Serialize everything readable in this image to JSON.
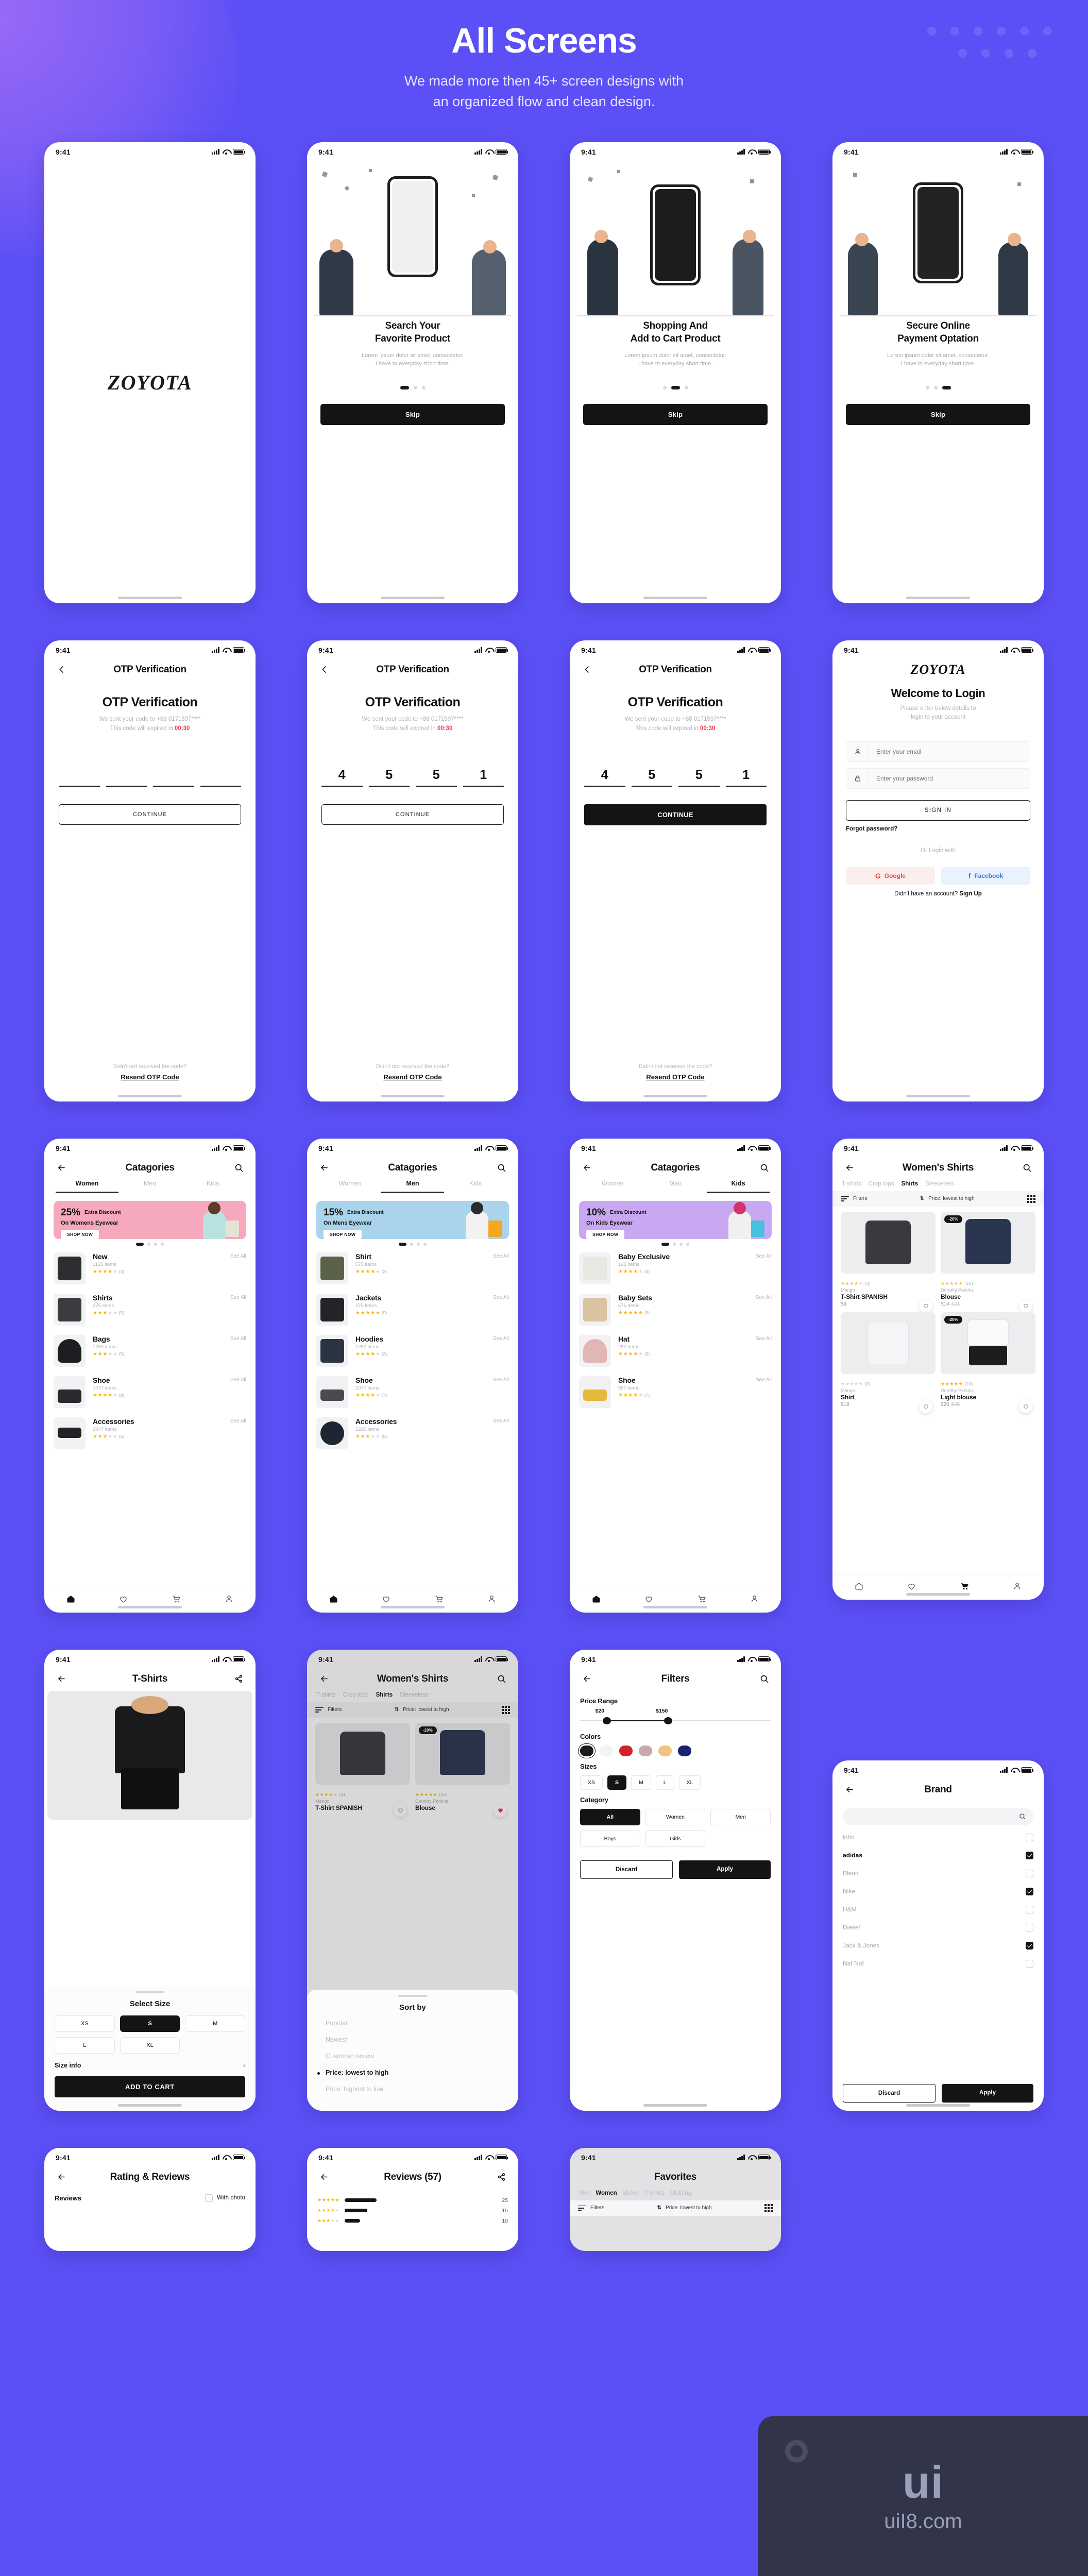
{
  "header": {
    "title": "All Screens",
    "subtitle_line1": "We made more then 45+ screen designs with",
    "subtitle_line2": "an organized flow and clean design."
  },
  "status_bar": {
    "time": "9:41"
  },
  "brand": {
    "name": "ZOYOTA"
  },
  "screens": {
    "splash": {
      "logo": "ZOYOTA"
    },
    "onboarding": [
      {
        "title_line1": "Search Your",
        "title_line2": "Favorite Product",
        "desc_line1": "Lorem ipsum dolor sit amet, consectetur.",
        "desc_line2": "I have to  everyday short time.",
        "button": "Skip",
        "active_dot": 0
      },
      {
        "title_line1": "Shopping And",
        "title_line2": "Add to Cart Product",
        "desc_line1": "Lorem ipsum dolor sit amet, consectetur.",
        "desc_line2": "I have to  everyday short time.",
        "button": "Skip",
        "active_dot": 1
      },
      {
        "title_line1": "Secure Online",
        "title_line2": "Payment Optation",
        "desc_line1": "Lorem ipsum dolor sit amet, consectetur.",
        "desc_line2": "I have to  everyday short time.",
        "button": "Skip",
        "active_dot": 2
      }
    ],
    "otp": {
      "nav_title": "OTP Verification",
      "heading": "OTP Verification",
      "sent_text": "We sent your code to +88 0171597****",
      "expire_prefix": "This code will expired in ",
      "timer": "00:30",
      "continue": "CONTINUE",
      "question": "Didn't not received the code?",
      "resend": "Resend OTP Code",
      "code_empty": [
        "",
        "",
        "",
        ""
      ],
      "code_filled": [
        "4",
        "5",
        "5",
        "1"
      ]
    },
    "login": {
      "logo": "ZOYOTA",
      "heading": "Welcome to Login",
      "sub_line1": "Please enter below details to",
      "sub_line2": "login to your account",
      "email_placeholder": "Enter your email",
      "password_placeholder": "Enter your password",
      "signin": "SIGN IN",
      "forgot": "Forgot password?",
      "or": "Or Login with",
      "google": "Google",
      "facebook": "Facebook",
      "no_account": "Didn't have an account? ",
      "signup": "Sign Up"
    },
    "categories": {
      "nav_title": "Catagories",
      "tabs": [
        "Women",
        "Men",
        "Kids"
      ],
      "see_all": "See All",
      "women": {
        "active_tab": "Women",
        "promo": {
          "percent": "25%",
          "extra": "Extra Discount",
          "line2": "On Womens Eyewear",
          "cta": "SHOP NOW",
          "color": "#f6a8bd"
        },
        "items": [
          {
            "name": "New",
            "items": "1125 items",
            "stars": 4,
            "count": "(3)"
          },
          {
            "name": "Shirts",
            "items": "275 items",
            "stars": 3,
            "count": "(5)"
          },
          {
            "name": "Bags",
            "items": "1250 items",
            "stars": 3,
            "count": "(5)"
          },
          {
            "name": "Shoe",
            "items": "1077 items",
            "stars": 4,
            "count": "(9)"
          },
          {
            "name": "Accessories",
            "items": "2047 items",
            "stars": 3,
            "count": "(5)"
          }
        ]
      },
      "men": {
        "active_tab": "Men",
        "promo": {
          "percent": "15%",
          "extra": "Extra Discount",
          "line2": "On Mens Eyewear",
          "cta": "SHOP NOW",
          "color": "#a9d4ec"
        },
        "items": [
          {
            "name": "Shirt",
            "items": "575 items",
            "stars": 4,
            "count": "(3)"
          },
          {
            "name": "Jackets",
            "items": "275 items",
            "stars": 5,
            "count": "(9)"
          },
          {
            "name": "Hoodies",
            "items": "1250 items",
            "stars": 4,
            "count": "(3)"
          },
          {
            "name": "Shoe",
            "items": "1077 items",
            "stars": 4,
            "count": "(7)"
          },
          {
            "name": "Accessories",
            "items": "1225 items",
            "stars": 3,
            "count": "(5)"
          }
        ]
      },
      "kids": {
        "active_tab": "Kids",
        "promo": {
          "percent": "10%",
          "extra": "Extra Discount",
          "line2": "On Kids Eyewear",
          "cta": "SHOP NOW",
          "color": "#c9a8f3"
        },
        "items": [
          {
            "name": "Baby Exclusive",
            "items": "125 items",
            "stars": 4,
            "count": "(3)"
          },
          {
            "name": "Baby Sets",
            "items": "575 items",
            "stars": 5,
            "count": "(9)"
          },
          {
            "name": "Hat",
            "items": "250 items",
            "stars": 4,
            "count": "(3)"
          },
          {
            "name": "Shoe",
            "items": "557 items",
            "stars": 4,
            "count": "(7)"
          }
        ]
      }
    },
    "womens_shirts": {
      "nav_title": "Women's Shirts",
      "tabs": [
        "T-shirts",
        "Crop tops",
        "Shirts",
        "Sleeveless"
      ],
      "active_tab": "Shirts",
      "filters_label": "Filters",
      "sort_label": "Price: lowest to high",
      "products": [
        {
          "brand": "Mango",
          "name": "T-Shirt SPANISH",
          "price": "$9",
          "old_price": "",
          "stars": 4,
          "count": "(3)",
          "badge": "",
          "liked": false
        },
        {
          "brand": "Dorothy Perkins",
          "name": "Blouse",
          "price": "$14",
          "old_price": "$21",
          "stars": 5,
          "count": "(10)",
          "badge": "-20%",
          "liked": false
        },
        {
          "brand": "Mango",
          "name": "Shirt",
          "price": "$18",
          "old_price": "",
          "stars": 0,
          "count": "(0)",
          "badge": "",
          "liked": false
        },
        {
          "brand": "Dorothy Perkins",
          "name": "Light blouse",
          "price": "$20",
          "old_price": "$25",
          "stars": 5,
          "count": "(10)",
          "badge": "-20%",
          "liked": false
        }
      ]
    },
    "brand_filter": {
      "nav_title": "Brand",
      "search_placeholder": "",
      "brands": [
        {
          "name": "lotto",
          "checked": false
        },
        {
          "name": "adidas",
          "checked": true
        },
        {
          "name": "Blend",
          "checked": false
        },
        {
          "name": "Nike",
          "checked": true
        },
        {
          "name": "H&M",
          "checked": false
        },
        {
          "name": "Diesel",
          "checked": false
        },
        {
          "name": "Jack & Jones",
          "checked": true
        },
        {
          "name": "Naf Naf",
          "checked": false
        }
      ],
      "discard": "Discard",
      "apply": "Apply"
    },
    "tshirt_detail": {
      "nav_title": "T-Shirts",
      "sheet_title": "Select Size",
      "sizes": [
        "XS",
        "S",
        "M",
        "L",
        "XL"
      ],
      "selected_size": "S",
      "size_info": "Size info",
      "add_to_cart": "ADD TO CART"
    },
    "sort_sheet": {
      "nav_title": "Women's Shirts",
      "sheet_title": "Sort by",
      "options": [
        "Popular",
        "Newest",
        "Customer review",
        "Price: lowest to high",
        "Price: highest to low"
      ],
      "selected": "Price: lowest to high"
    },
    "filters": {
      "nav_title": "Filters",
      "price_range_label": "Price Range",
      "price_min": "$20",
      "price_max": "$150",
      "colors_label": "Colors",
      "colors": [
        "#1c1c1c",
        "#f3f3f3",
        "#d32128",
        "#c9a9ab",
        "#efc382",
        "#1b2370"
      ],
      "selected_color": "#1c1c1c",
      "sizes_label": "Sizes",
      "sizes": [
        "XS",
        "S",
        "M",
        "L",
        "XL"
      ],
      "selected_size": "S",
      "category_label": "Category",
      "categories": [
        "All",
        "Women",
        "Men",
        "Boys",
        "Girls"
      ],
      "selected_category": "All",
      "discard": "Discard",
      "apply": "Apply"
    },
    "rating_reviews": {
      "nav_title": "Rating & Reviews",
      "section_label": "Reviews",
      "with_photo": "With photo"
    },
    "reviews": {
      "nav_title": "Reviews (57)",
      "bars": [
        {
          "stars": 5,
          "count": "25",
          "width": 62
        },
        {
          "stars": 4,
          "count": "15",
          "width": 44
        },
        {
          "stars": 3,
          "count": "10",
          "width": 30
        }
      ]
    },
    "favorites": {
      "nav_title": "Favorites",
      "tabs": [
        "Men",
        "Women",
        "Shoes",
        "T-Shirts",
        "Clothing"
      ],
      "active_tab": "Women",
      "filters_label": "Filters",
      "sort_label": "Price: lowest to high"
    }
  },
  "watermark": {
    "main": "ui",
    "sub": "uiI8.com"
  }
}
